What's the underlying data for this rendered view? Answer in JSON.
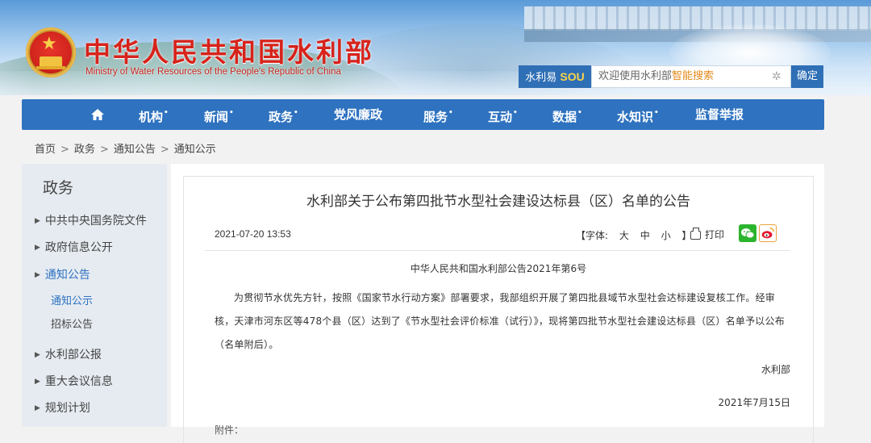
{
  "header": {
    "title": "中华人民共和国水利部",
    "subtitle": "Ministry of Water Resources of the People's Republic of China",
    "search": {
      "logo_prefix": "水利易",
      "logo_brand": "SOU",
      "placeholder_normal": "欢迎使用水利部",
      "placeholder_highlight": "智能搜索",
      "button": "确定"
    }
  },
  "nav": {
    "home_icon": "home-icon",
    "items": [
      {
        "label": "机构",
        "dropdown": true
      },
      {
        "label": "新闻",
        "dropdown": true
      },
      {
        "label": "政务",
        "dropdown": true
      },
      {
        "label": "党风廉政",
        "dropdown": false
      },
      {
        "label": "服务",
        "dropdown": true
      },
      {
        "label": "互动",
        "dropdown": true
      },
      {
        "label": "数据",
        "dropdown": true
      },
      {
        "label": "水知识",
        "dropdown": true
      },
      {
        "label": "监督举报",
        "dropdown": false
      }
    ],
    "dropdown_mark": "•"
  },
  "breadcrumb": {
    "items": [
      "首页",
      "政务",
      "通知公告",
      "通知公示"
    ],
    "separator": ">"
  },
  "sidebar": {
    "title": "政务",
    "items": [
      {
        "label": "中共中央国务院文件"
      },
      {
        "label": "政府信息公开"
      },
      {
        "label": "通知公告"
      },
      {
        "label": "水利部公报"
      },
      {
        "label": "重大会议信息"
      },
      {
        "label": "规划计划"
      }
    ],
    "subitems": [
      {
        "label": "通知公示"
      },
      {
        "label": "招标公告"
      }
    ],
    "active_item": "通知公告",
    "active_subitem": "通知公示"
  },
  "article": {
    "title": "水利部关于公布第四批节水型社会建设达标县（区）名单的公告",
    "date": "2021-07-20 13:53",
    "font_label": "【字体:",
    "font_sizes": [
      "大",
      "中",
      "小"
    ],
    "font_close": "】",
    "print": "打印",
    "doc_number": "中华人民共和国水利部公告2021年第6号",
    "body": "为贯彻节水优先方针，按照《国家节水行动方案》部署要求，我部组织开展了第四批县域节水型社会达标建设复核工作。经审核，天津市河东区等478个县（区）达到了《节水型社会评价标准（试行）》，现将第四批节水型社会建设达标县（区）名单予以公布（名单附后）。",
    "signer": "水利部",
    "sign_date": "2021年7月15日",
    "attachment_partial": "附件："
  },
  "colors": {
    "nav_bg": "#2e72c0",
    "title_red": "#d7231b",
    "active_blue": "#2e72c0",
    "search_highlight": "#e58a1c"
  }
}
